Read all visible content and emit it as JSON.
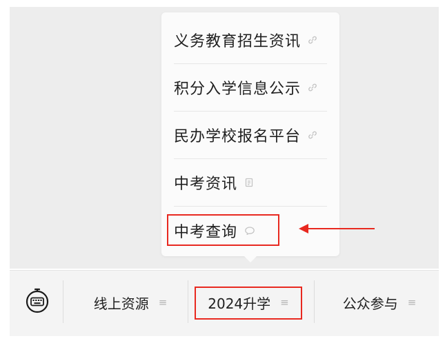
{
  "popup_menu": {
    "items": [
      {
        "label": "义务教育招生资讯",
        "icon": "link-icon"
      },
      {
        "label": "积分入学信息公示",
        "icon": "link-icon"
      },
      {
        "label": "民办学校报名平台",
        "icon": "link-icon"
      },
      {
        "label": "中考资讯",
        "icon": "document-icon"
      },
      {
        "label": "中考查询",
        "icon": "chat-bubble-icon"
      }
    ]
  },
  "bottom_menu": {
    "keyboard_icon": "keyboard-icon",
    "tabs": [
      {
        "label": "线上资源",
        "menu_glyph": "≡"
      },
      {
        "label": "2024升学",
        "menu_glyph": "≡"
      },
      {
        "label": "公众参与",
        "menu_glyph": "≡"
      }
    ]
  },
  "annotation": {
    "color": "#e8281f"
  }
}
